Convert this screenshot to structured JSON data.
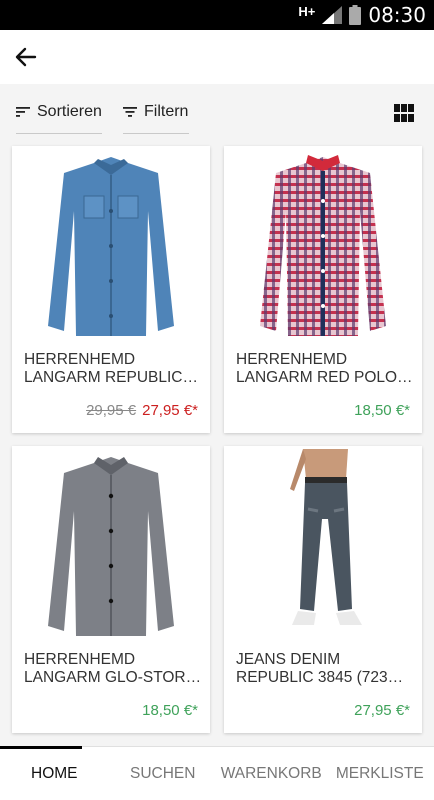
{
  "status_bar": {
    "network": "H+",
    "time": "08:30"
  },
  "toolbar": {
    "sort_label": "Sortieren",
    "filter_label": "Filtern"
  },
  "products": [
    {
      "title_line1": "HERRENHEMD",
      "title_line2": "LANGARM REPUBLIC…",
      "old_price": "29,95 €",
      "price": "27,95 €*"
    },
    {
      "title_line1": "HERRENHEMD",
      "title_line2": "LANGARM RED POLO…",
      "price": "18,50 €*"
    },
    {
      "title_line1": "HERRENHEMD",
      "title_line2": "LANGARM GLO-STOR…",
      "price": "18,50 €*"
    },
    {
      "title_line1": "JEANS DENIM",
      "title_line2": "REPUBLIC 3845 (723…",
      "price": "27,95 €*"
    }
  ],
  "bottom_nav": {
    "home": "HOME",
    "search": "SUCHEN",
    "cart": "WARENKORB",
    "wishlist": "MERKLISTE"
  },
  "colors": {
    "sale": "#cc1f1f",
    "price": "#3fa25a",
    "accent": "#000000"
  }
}
